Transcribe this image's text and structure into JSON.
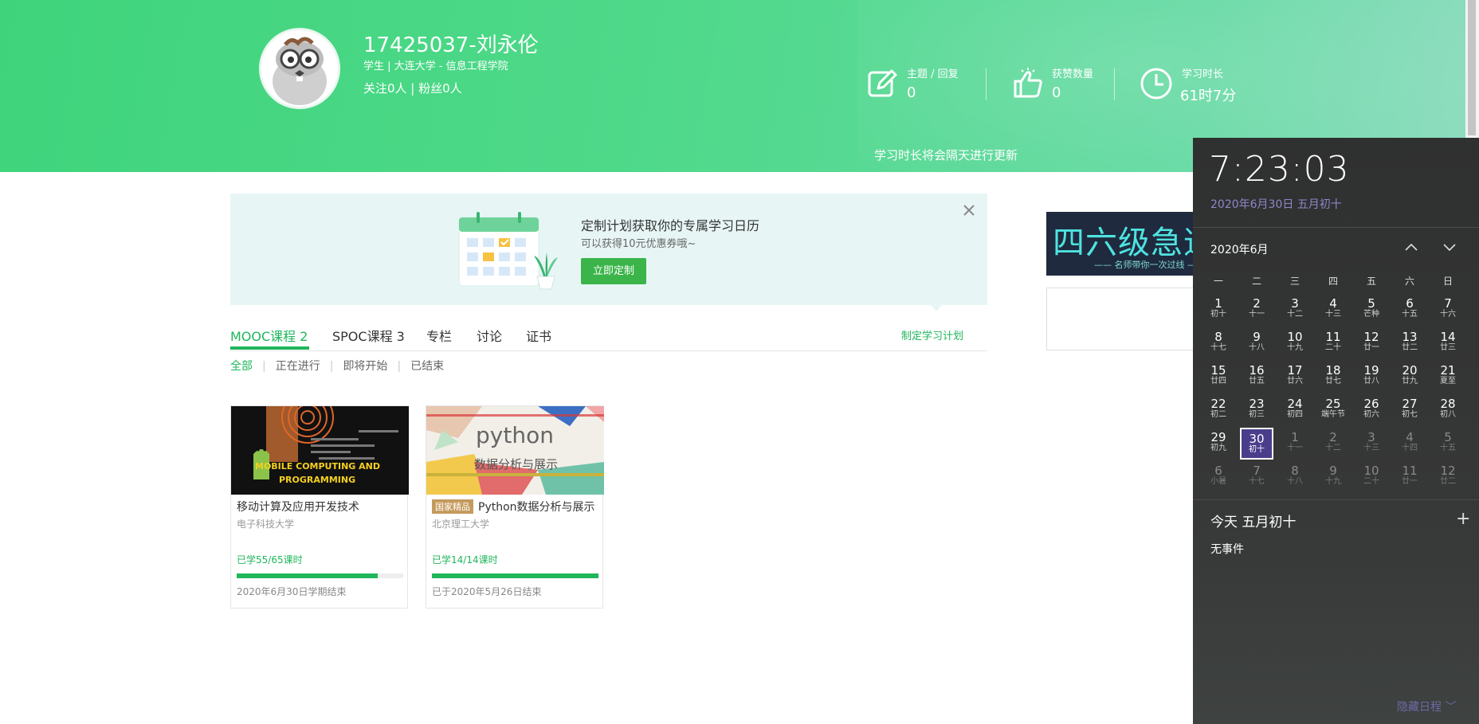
{
  "profile": {
    "name": "17425037-刘永伦",
    "info": "学生 | 大连大学 - 信息工程学院",
    "follow": "关注0人 | 粉丝0人"
  },
  "stats": [
    {
      "label": "主题 / 回复",
      "value": "0",
      "icon": "edit-icon"
    },
    {
      "label": "获赞数量",
      "value": "0",
      "icon": "thumbs-up-icon"
    },
    {
      "label": "学习时长",
      "value": "61时7分",
      "icon": "clock-icon"
    }
  ],
  "stats_note": "学习时长将会隔天进行更新",
  "promo": {
    "title": "定制计划获取你的专属学习日历",
    "subtitle": "可以获得10元优惠券哦~",
    "button": "立即定制"
  },
  "tabs": [
    {
      "label": "MOOC课程 2",
      "active": true
    },
    {
      "label": "SPOC课程 3"
    },
    {
      "label": "专栏"
    },
    {
      "label": "讨论"
    },
    {
      "label": "证书"
    }
  ],
  "plan_link": "制定学习计划",
  "filters": [
    "全部",
    "正在进行",
    "即将开始",
    "已结束"
  ],
  "courses": [
    {
      "thumb_text_1": "MOBILE COMPUTING AND",
      "thumb_text_2": "PROGRAMMING",
      "tag": "",
      "title": "移动计算及应用开发技术",
      "school": "电子科技大学",
      "progress_text": "已学55/65课时",
      "progress": 0.846,
      "end": "2020年6月30日学期结束"
    },
    {
      "thumb_text_1": "python",
      "thumb_text_2": "数据分析与展示",
      "tag": "国家精品",
      "title": "Python数据分析与展示",
      "school": "北京理工大学",
      "progress_text": "已学14/14课时",
      "progress": 1.0,
      "end": "已于2020年5月26日结束"
    }
  ],
  "ad": {
    "big": "四六级急速通",
    "small": "—— 名师带你一次过线 ——"
  },
  "calendar": {
    "time": "7:23:03",
    "date": "2020年6月30日 五月初十",
    "month": "2020年6月",
    "weekdays": [
      "一",
      "二",
      "三",
      "四",
      "五",
      "六",
      "日"
    ],
    "days": [
      {
        "n": "1",
        "l": "初十"
      },
      {
        "n": "2",
        "l": "十一"
      },
      {
        "n": "3",
        "l": "十二"
      },
      {
        "n": "4",
        "l": "十三"
      },
      {
        "n": "5",
        "l": "芒种"
      },
      {
        "n": "6",
        "l": "十五"
      },
      {
        "n": "7",
        "l": "十六"
      },
      {
        "n": "8",
        "l": "十七"
      },
      {
        "n": "9",
        "l": "十八"
      },
      {
        "n": "10",
        "l": "十九"
      },
      {
        "n": "11",
        "l": "二十"
      },
      {
        "n": "12",
        "l": "廿一"
      },
      {
        "n": "13",
        "l": "廿二"
      },
      {
        "n": "14",
        "l": "廿三"
      },
      {
        "n": "15",
        "l": "廿四"
      },
      {
        "n": "16",
        "l": "廿五"
      },
      {
        "n": "17",
        "l": "廿六"
      },
      {
        "n": "18",
        "l": "廿七"
      },
      {
        "n": "19",
        "l": "廿八"
      },
      {
        "n": "20",
        "l": "廿九"
      },
      {
        "n": "21",
        "l": "夏至"
      },
      {
        "n": "22",
        "l": "初二"
      },
      {
        "n": "23",
        "l": "初三"
      },
      {
        "n": "24",
        "l": "初四"
      },
      {
        "n": "25",
        "l": "端午节"
      },
      {
        "n": "26",
        "l": "初六"
      },
      {
        "n": "27",
        "l": "初七"
      },
      {
        "n": "28",
        "l": "初八"
      },
      {
        "n": "29",
        "l": "初九"
      },
      {
        "n": "30",
        "l": "初十",
        "selected": true
      },
      {
        "n": "1",
        "l": "十一",
        "other": true
      },
      {
        "n": "2",
        "l": "十二",
        "other": true
      },
      {
        "n": "3",
        "l": "十三",
        "other": true
      },
      {
        "n": "4",
        "l": "十四",
        "other": true
      },
      {
        "n": "5",
        "l": "十五",
        "other": true
      },
      {
        "n": "6",
        "l": "小暑",
        "other": true
      },
      {
        "n": "7",
        "l": "十七",
        "other": true
      },
      {
        "n": "8",
        "l": "十八",
        "other": true
      },
      {
        "n": "9",
        "l": "十九",
        "other": true
      },
      {
        "n": "10",
        "l": "二十",
        "other": true
      },
      {
        "n": "11",
        "l": "廿一",
        "other": true
      },
      {
        "n": "12",
        "l": "廿二",
        "other": true
      }
    ],
    "today": "今天 五月初十",
    "no_events": "无事件",
    "hide": "隐藏日程 ﹀"
  }
}
